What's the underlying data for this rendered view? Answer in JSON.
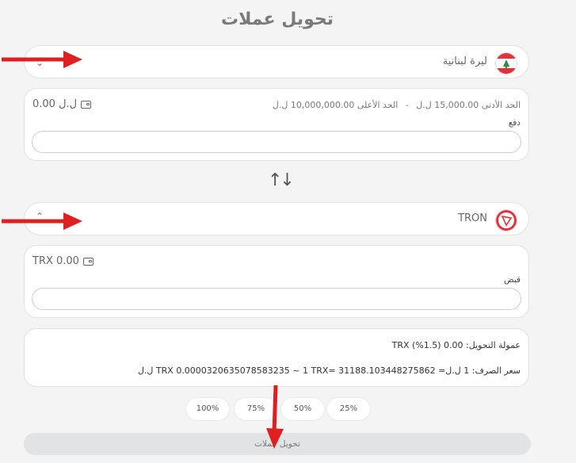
{
  "page": {
    "title": "تحويل عملات"
  },
  "from": {
    "currency": "ليرة لبنانية",
    "balance": "0.00 ل.ل",
    "min_limit": "الحد الأدنى 15,000.00 ل.ل",
    "separator": "-",
    "max_limit": "الحد الأعلى 10,000,000.00 ل.ل",
    "label": "دفع",
    "value": ""
  },
  "to": {
    "currency": "TRON",
    "balance": "TRX 0.00",
    "label": "قبض",
    "value": ""
  },
  "info": {
    "fee": "عمولة التحويل: 0.00 TRX (%1.5)",
    "rate": "سعر الصرف: 1 ل.ل= TRX 0.0000320635078583235 ~ 1 TRX= 31188.103448275862 ل.ل"
  },
  "percent_buttons": [
    "100%",
    "75%",
    "50%",
    "25%"
  ],
  "submit_label": "تحويل عملات",
  "colors": {
    "accent_red": "#e02020",
    "tron_red": "#e8303a",
    "lebanon_green": "#2e8b3d"
  }
}
